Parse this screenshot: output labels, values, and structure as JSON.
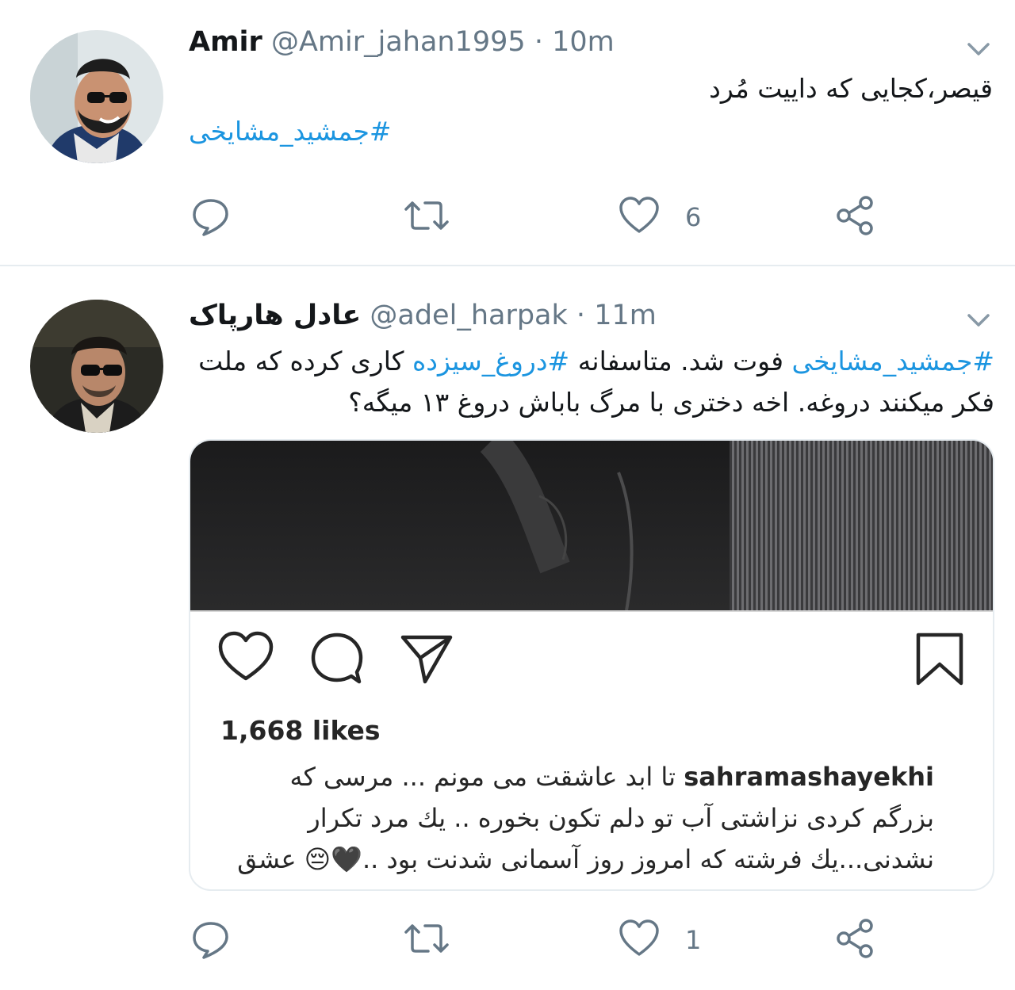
{
  "tweets": [
    {
      "name": "Amir",
      "handle": "@Amir_jahan1995",
      "separator": "·",
      "time": "10m",
      "text": "قیصر،کجایی که داییت مُرد",
      "hashtag": "#جمشید_مشایخی",
      "reply_count": "",
      "retweet_count": "",
      "like_count": "6"
    },
    {
      "name": "عادل هارپاک",
      "handle": "@adel_harpak",
      "separator": "·",
      "time": "11m",
      "hashtag1": "#جمشید_مشایخی",
      "text1": " فوت شد. متاسفانه ",
      "hashtag2": "#دروغ_سیزده",
      "text2": " کاری کرده که ملت فکر میکنند دروغه.  اخه دختری با مرگ باباش دروغ ۱۳ میگه؟",
      "reply_count": "",
      "retweet_count": "",
      "like_count": "1",
      "embed": {
        "likes": "1,668 likes",
        "username": "sahramashayekhi",
        "caption": " تا ابد عاشقت می مونم ... مرسی که بزرگم کردی نزاشتی آب تو دلم تکون بخوره .. یك مرد تکرار نشدنی...یك فرشته که امروز روز آسمانی شدنت بود ..🖤😔 عشق"
      }
    }
  ],
  "colors": {
    "link": "#1b95e0",
    "muted": "#657786",
    "divider": "#e6ecf0"
  },
  "icons": [
    "reply-icon",
    "retweet-icon",
    "like-icon",
    "share-icon",
    "chevron-down-icon",
    "ig-heart-icon",
    "ig-comment-icon",
    "ig-send-icon",
    "ig-bookmark-icon"
  ]
}
